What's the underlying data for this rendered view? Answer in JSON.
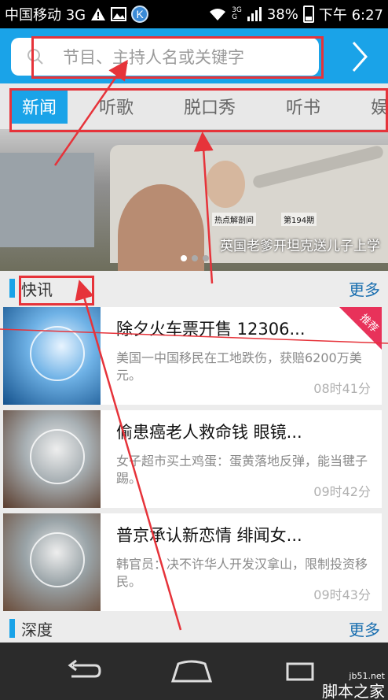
{
  "status_bar": {
    "carrier": "中国移动 3G",
    "battery": "38%",
    "time": "下午 6:27",
    "network_small_top": "3G",
    "network_small_bottom": "G"
  },
  "search": {
    "placeholder": "节目、主持人名或关键字"
  },
  "tabs": [
    {
      "label": "新闻",
      "active": true
    },
    {
      "label": "听歌"
    },
    {
      "label": "脱口秀"
    },
    {
      "label": "听书"
    },
    {
      "label": "娱"
    }
  ],
  "banner": {
    "tag": "热点解剖间",
    "issue": "第194期",
    "caption": "英国老爹开坦克送儿子上学"
  },
  "sections": {
    "news_flash": {
      "title": "快讯",
      "more": "更多"
    },
    "depth": {
      "title": "深度",
      "more": "更多"
    }
  },
  "news": [
    {
      "title": "除夕火车票开售 12306...",
      "desc": "美国一中国移民在工地跌伤，获赔6200万美元。",
      "time": "08时41分",
      "badge": "推荐"
    },
    {
      "title": "偷患癌老人救命钱 眼镜...",
      "desc": "女子超市买土鸡蛋：蛋黄落地反弹，能当毽子踢。",
      "time": "09时42分"
    },
    {
      "title": "普京承认新恋情 绯闻女...",
      "desc": "韩官员：决不许华人开发汉拿山，限制投资移民。",
      "time": "09时43分"
    }
  ],
  "watermark": {
    "top": "jb51.net",
    "bottom": "脚本之家"
  },
  "colors": {
    "accent": "#1aa3e8",
    "annotation": "#e6333a",
    "badge": "#e8325a"
  }
}
